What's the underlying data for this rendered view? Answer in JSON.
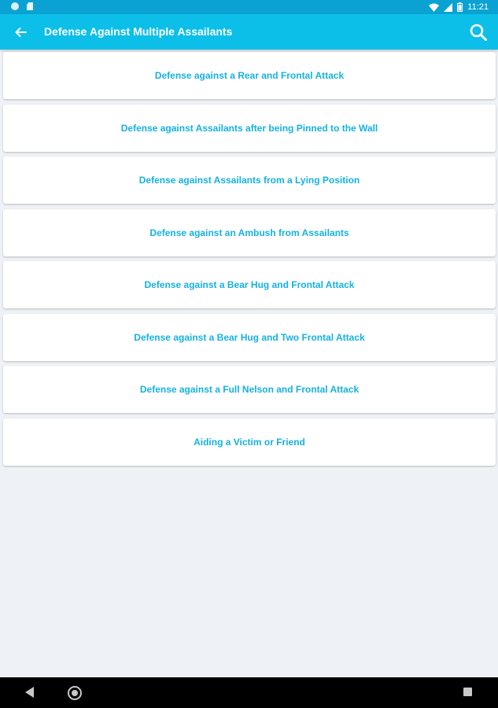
{
  "status_bar": {
    "time": "11:21",
    "icons": [
      "notification-dot-icon",
      "sd-card-icon",
      "wifi-icon",
      "signal-icon",
      "battery-icon"
    ]
  },
  "app_bar": {
    "title": "Defense Against Multiple Assailants",
    "back_icon": "arrow-left-icon",
    "search_icon": "search-icon",
    "background_color": "#0cbfe8"
  },
  "list": {
    "items": [
      {
        "label": "Defense against a Rear and Frontal Attack"
      },
      {
        "label": "Defense against Assailants after being Pinned to the Wall"
      },
      {
        "label": "Defense against Assailants from a Lying Position"
      },
      {
        "label": "Defense against an Ambush from Assailants"
      },
      {
        "label": "Defense against a Bear Hug and Frontal Attack"
      },
      {
        "label": "Defense against a Bear Hug and Two Frontal Attack"
      },
      {
        "label": "Defense against a Full Nelson and Frontal Attack"
      },
      {
        "label": "Aiding a Victim or Friend"
      }
    ],
    "label_color": "#15b1e0"
  },
  "nav_bar": {
    "buttons": [
      "back-triangle-icon",
      "home-circle-icon",
      "recents-square-icon"
    ]
  }
}
